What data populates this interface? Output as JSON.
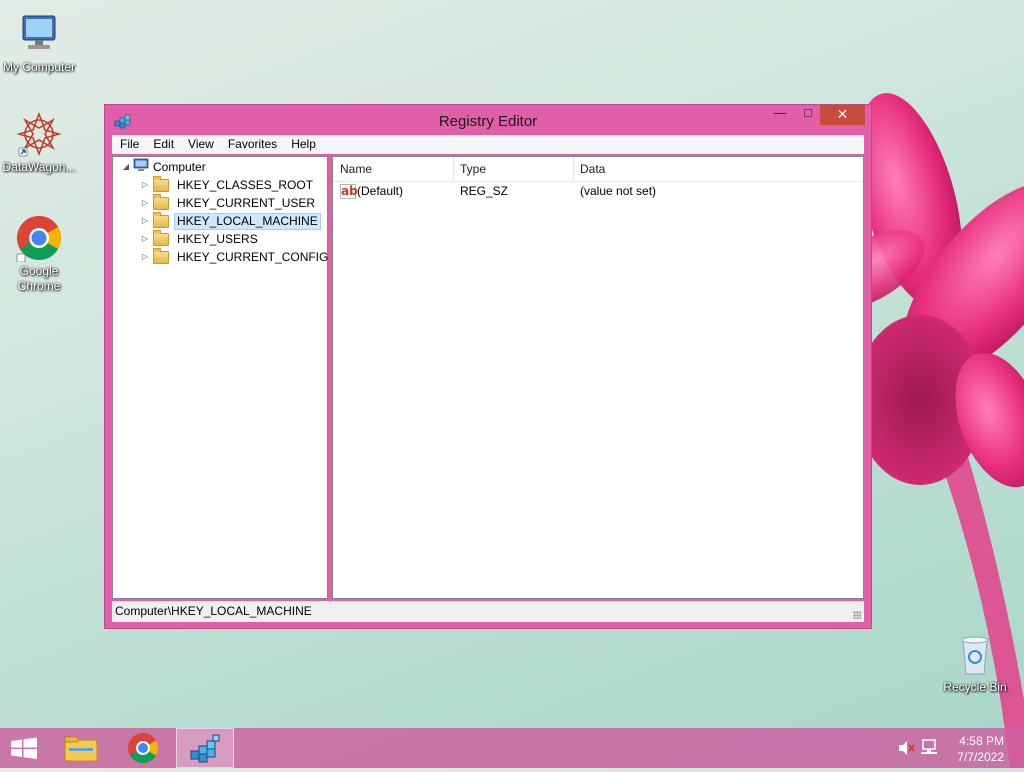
{
  "desktop": {
    "icons": [
      {
        "label": "My Computer"
      },
      {
        "label": "DataWagon..."
      },
      {
        "label": "Google Chrome"
      },
      {
        "label": "Recycle Bin"
      }
    ]
  },
  "window": {
    "title": "Registry Editor",
    "controls": {
      "minimize": "—",
      "maximize": "□",
      "close": "✕"
    },
    "menu": [
      "File",
      "Edit",
      "View",
      "Favorites",
      "Help"
    ],
    "tree": {
      "root": "Computer",
      "items": [
        {
          "label": "HKEY_CLASSES_ROOT"
        },
        {
          "label": "HKEY_CURRENT_USER"
        },
        {
          "label": "HKEY_LOCAL_MACHINE",
          "selected": true
        },
        {
          "label": "HKEY_USERS"
        },
        {
          "label": "HKEY_CURRENT_CONFIG"
        }
      ]
    },
    "list": {
      "columns": [
        "Name",
        "Type",
        "Data"
      ],
      "rows": [
        {
          "name": "(Default)",
          "type": "REG_SZ",
          "data": "(value not set)",
          "icon": "string-value-icon"
        }
      ]
    },
    "status": "Computer\\HKEY_LOCAL_MACHINE"
  },
  "taskbar": {
    "apps": [
      "start-button",
      "file-explorer",
      "google-chrome",
      "registry-editor"
    ],
    "clock": {
      "time": "4:58 PM",
      "date": "7/7/2022"
    }
  },
  "colors": {
    "accent": "#e05fa6",
    "taskbar": "#cd5fa0",
    "close": "#c94b3b",
    "selection": "#cce8ff"
  }
}
